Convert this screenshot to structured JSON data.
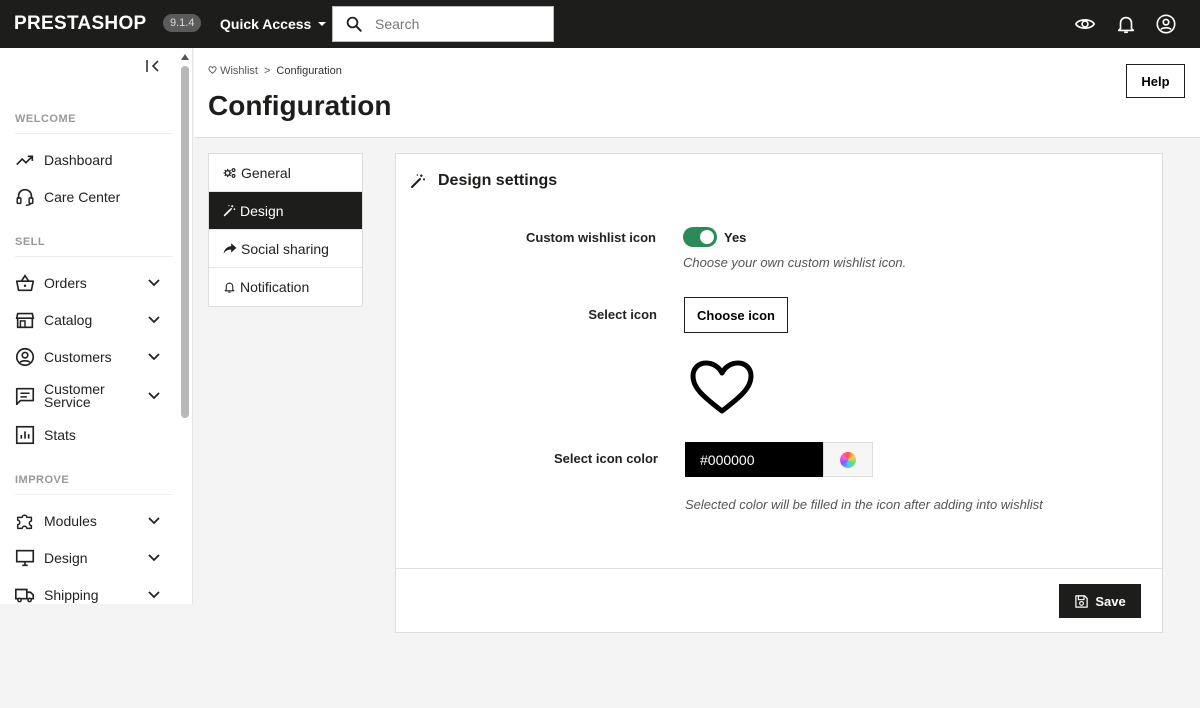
{
  "topbar": {
    "logo": "PRESTASHOP",
    "version": "9.1.4",
    "quick_access": "Quick Access",
    "search_placeholder": "Search",
    "icons": [
      "eye-icon",
      "bell-icon",
      "account-icon"
    ]
  },
  "sidebar": {
    "sections": {
      "welcome": "WELCOME",
      "sell": "SELL",
      "improve": "IMPROVE"
    },
    "items": [
      {
        "label": "Dashboard",
        "icon": "trending-up-icon",
        "expandable": false
      },
      {
        "label": "Care Center",
        "icon": "headset-icon",
        "expandable": false
      },
      {
        "label": "Orders",
        "icon": "basket-icon",
        "expandable": true
      },
      {
        "label": "Catalog",
        "icon": "store-icon",
        "expandable": true
      },
      {
        "label": "Customers",
        "icon": "account-circle-icon",
        "expandable": true
      },
      {
        "label": "Customer",
        "label2": "Service",
        "icon": "chat-icon",
        "expandable": true
      },
      {
        "label": "Stats",
        "icon": "bar-chart-icon",
        "expandable": false
      },
      {
        "label": "Modules",
        "icon": "puzzle-icon",
        "expandable": true
      },
      {
        "label": "Design",
        "icon": "monitor-icon",
        "expandable": true
      },
      {
        "label": "Shipping",
        "icon": "truck-icon",
        "expandable": true
      }
    ]
  },
  "header": {
    "breadcrumb": {
      "parent": "Wishlist",
      "current": "Configuration",
      "separator": ">"
    },
    "title": "Configuration",
    "help_label": "Help"
  },
  "tabs": [
    {
      "label": "General",
      "icon": "cogs-icon",
      "active": false
    },
    {
      "label": "Design",
      "icon": "magic-wand-icon",
      "active": true
    },
    {
      "label": "Social sharing",
      "icon": "share-icon",
      "active": false
    },
    {
      "label": "Notification",
      "icon": "bell-icon",
      "active": false
    }
  ],
  "panel": {
    "title": "Design settings",
    "custom_icon_label": "Custom wishlist icon",
    "custom_icon_value": "Yes",
    "custom_icon_help": "Choose your own custom wishlist icon.",
    "select_icon_label": "Select icon",
    "choose_icon_button": "Choose icon",
    "select_color_label": "Select icon color",
    "color_value": "#000000",
    "color_help": "Selected color will be filled in the icon after adding into wishlist",
    "save_label": "Save"
  },
  "colors": {
    "dark": "#1d1d1b",
    "toggle_on": "#2c8a57",
    "background": "#f4f4f4"
  }
}
